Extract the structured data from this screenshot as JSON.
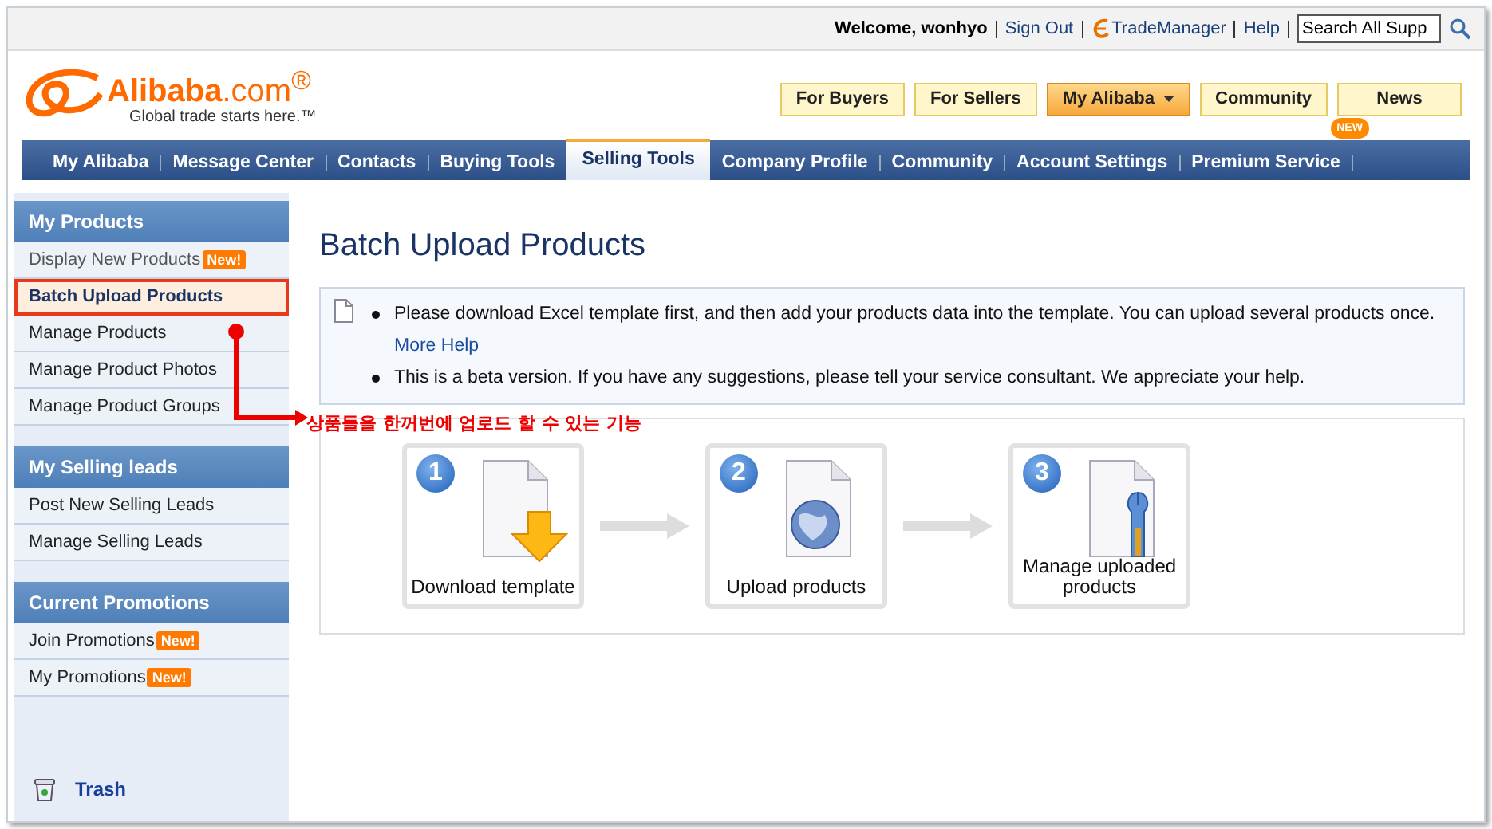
{
  "top_bar": {
    "welcome": "Welcome, wonhyo",
    "links": [
      {
        "label": "Sign Out",
        "kind": "link"
      },
      {
        "label": "TradeManager",
        "kind": "trademanager"
      },
      {
        "label": "Help",
        "kind": "link"
      }
    ],
    "search": {
      "value": "Search All Supp"
    }
  },
  "logo": {
    "brand": "**Alibaba**.com$^{®}$",
    "tagline": "Global trade starts here.™"
  },
  "header_buttons": [
    {
      "label": "For Buyers",
      "selected": false,
      "dropdown": false
    },
    {
      "label": "For Sellers",
      "selected": false,
      "dropdown": false
    },
    {
      "label": "My Alibaba",
      "selected": true,
      "dropdown": true
    },
    {
      "label": "Community",
      "selected": false,
      "dropdown": false
    },
    {
      "label": "News",
      "selected": false,
      "dropdown": false
    }
  ],
  "nav_tabs": [
    {
      "label": "My Alibaba",
      "selected": false
    },
    {
      "label": "Message Center",
      "selected": false
    },
    {
      "label": "Contacts",
      "selected": false
    },
    {
      "label": "Buying Tools",
      "selected": false
    },
    {
      "label": "Selling Tools",
      "selected": true
    },
    {
      "label": "Company Profile",
      "selected": false
    },
    {
      "label": "Community",
      "selected": false
    },
    {
      "label": "Account Settings",
      "selected": false
    },
    {
      "label": "Premium Service",
      "selected": false,
      "badge": "NEW"
    }
  ],
  "sidebar": {
    "sections": [
      {
        "title": "My Products",
        "items": [
          {
            "label": "Display New Products",
            "badge": "New!",
            "selected": false
          },
          {
            "label": "Batch Upload Products",
            "selected": true
          },
          {
            "label": "Manage Products",
            "selected": false
          },
          {
            "label": "Manage Product Photos",
            "selected": false
          },
          {
            "label": "Manage Product Groups",
            "selected": false
          }
        ]
      },
      {
        "title": "My Selling leads",
        "items": [
          {
            "label": "Post New Selling Leads",
            "selected": false
          },
          {
            "label": "Manage Selling Leads",
            "selected": false
          }
        ]
      },
      {
        "title": "Current Promotions",
        "items": [
          {
            "label": "Join Promotions",
            "badge": "New!",
            "selected": false
          },
          {
            "label": "My Promotions",
            "badge": "New!",
            "selected": false
          }
        ]
      }
    ],
    "trash": "Trash"
  },
  "annotation": {
    "text": "상품들을 한꺼번에 업로드 할 수 있는 기능"
  },
  "content": {
    "title": "Batch Upload Products",
    "notices": [
      {
        "text": "Please download Excel template first, and then add your products data into the template. You can upload several products once.",
        "link": "More Help"
      },
      {
        "text": "This is a beta version. If you have any suggestions, please tell your service consultant. We appreciate your help."
      }
    ],
    "steps": [
      {
        "number": "1",
        "label": "Download template",
        "kind": "download"
      },
      {
        "number": "2",
        "label": "Upload products",
        "kind": "globe"
      },
      {
        "number": "3",
        "label": "Manage uploaded products",
        "kind": "wrench"
      }
    ]
  }
}
